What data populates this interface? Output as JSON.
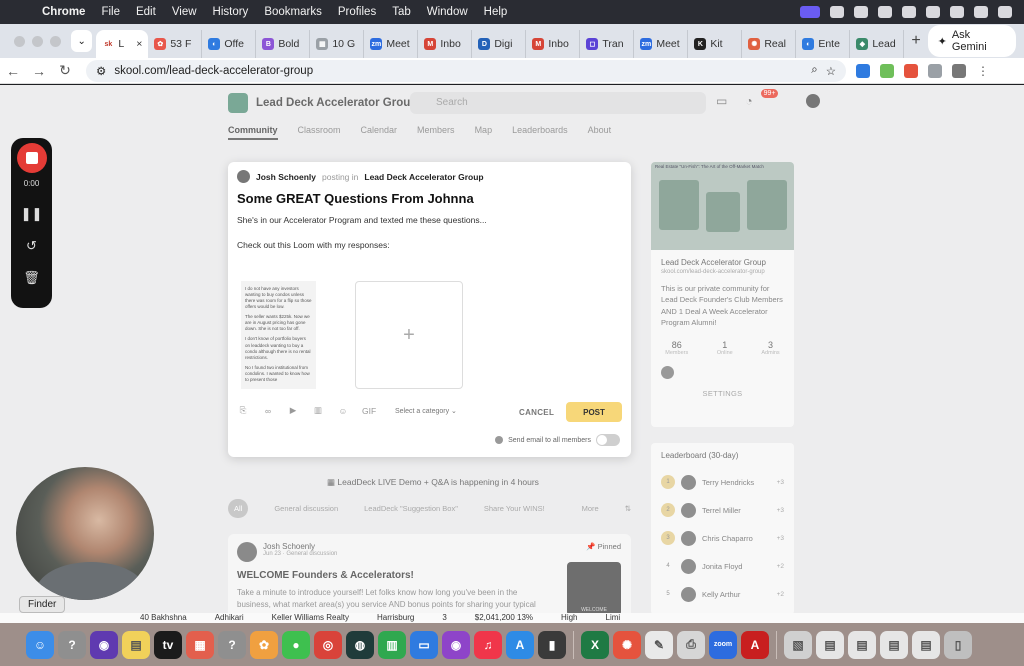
{
  "menubar": {
    "app": "Chrome",
    "items": [
      "File",
      "Edit",
      "View",
      "History",
      "Bookmarks",
      "Profiles",
      "Tab",
      "Window",
      "Help"
    ]
  },
  "tabs": [
    {
      "label": "L",
      "fav": "sk",
      "color": "#ffffff",
      "active": true
    },
    {
      "label": "53 F",
      "fav": "✿",
      "color": "#e8574b"
    },
    {
      "label": "Offe",
      "fav": "◐",
      "color": "#2f7be0"
    },
    {
      "label": "Bold",
      "fav": "B",
      "color": "#8c55d6"
    },
    {
      "label": "10 G",
      "fav": "▦",
      "color": "#9aa0a6"
    },
    {
      "label": "Meet",
      "fav": "zm",
      "color": "#2d6cdf"
    },
    {
      "label": "Inbo",
      "fav": "M",
      "color": "#d64537"
    },
    {
      "label": "Digi",
      "fav": "D",
      "color": "#2361b8"
    },
    {
      "label": "Inbo",
      "fav": "M",
      "color": "#d64537"
    },
    {
      "label": "Tran",
      "fav": "◻",
      "color": "#5b43d6"
    },
    {
      "label": "Meet",
      "fav": "zm",
      "color": "#2d6cdf"
    },
    {
      "label": "Kit",
      "fav": "K",
      "color": "#222222"
    },
    {
      "label": "Real",
      "fav": "✺",
      "color": "#e06040"
    },
    {
      "label": "Ente",
      "fav": "◐",
      "color": "#2f7be0"
    },
    {
      "label": "Lead",
      "fav": "◆",
      "color": "#3b8a6a"
    }
  ],
  "browser": {
    "new_tab": "+",
    "ask_gemini": "Ask Gemini",
    "url": "skool.com/lead-deck-accelerator-group"
  },
  "skool": {
    "group_name": "Lead Deck Accelerator Group",
    "search_placeholder": "Search",
    "notif_badge": "99+",
    "nav": [
      "Community",
      "Classroom",
      "Calendar",
      "Members",
      "Map",
      "Leaderboards",
      "About"
    ]
  },
  "composer": {
    "author": "Josh Schoenly",
    "posting_in": "posting in",
    "group": "Lead Deck Accelerator Group",
    "title": "Some GREAT Questions From Johnna",
    "body_line1": "She's in our Accelerator Program and texted me these questions...",
    "body_line2": "Check out this Loom with my responses:",
    "thumb_lines": [
      "I do not have any investors wanting to buy condos unless there was room for a flip so those offers would be low.",
      "The seller wants $225k. Now we are in August pricing has gone down. She is not too far off.",
      "I don't know of portfolio buyers on leaddeck wanting to buy a condo although there is no rental restrictions.",
      "No I found two institutional from condolins. I wanted to know how to present those"
    ],
    "add_symbol": "+",
    "gif_label": "GIF",
    "category_placeholder": "Select a category",
    "cancel_label": "CANCEL",
    "post_label": "POST",
    "email_label": "Send email to all members"
  },
  "feed": {
    "live_banner": "LeadDeck LIVE Demo + Q&A is happening in 4 hours",
    "filters": [
      "All",
      "General discussion",
      "LeadDeck \"Suggestion Box\"",
      "Share Your WINS!",
      "More"
    ],
    "pinned_post": {
      "author": "Josh Schoenly",
      "meta": "Jun 23 · General discussion",
      "pinned_label": "Pinned",
      "title": "WELCOME Founders & Accelerators!",
      "body": "Take a minute to introduce yourself! Let folks know how long you've been in the business, what market area(s) you service AND bonus points for sharing your typical",
      "image_caption": "WELCOME"
    }
  },
  "about": {
    "cover_title": "Real Estate \"Un-Fish\": The Art of the Off-Market Match",
    "name": "Lead Deck Accelerator Group",
    "url": "skool.com/lead-deck-accelerator-group",
    "description": "This is our private community for Lead Deck Founder's Club Members AND 1 Deal A Week Accelerator Program Alumni!",
    "stats": [
      {
        "value": "86",
        "label": "Members"
      },
      {
        "value": "1",
        "label": "Online"
      },
      {
        "value": "3",
        "label": "Admins"
      }
    ],
    "settings_label": "SETTINGS"
  },
  "leaderboard": {
    "title": "Leaderboard (30-day)",
    "rows": [
      {
        "rank": "1",
        "name": "Terry Hendricks",
        "points": "+3"
      },
      {
        "rank": "2",
        "name": "Terrel Miller",
        "points": "+3"
      },
      {
        "rank": "3",
        "name": "Chris Chaparro",
        "points": "+3"
      },
      {
        "rank": "4",
        "name": "Jonita Floyd",
        "points": "+2"
      },
      {
        "rank": "5",
        "name": "Kelly Arthur",
        "points": "+2"
      }
    ]
  },
  "loom": {
    "timer": "0:00"
  },
  "finder_tooltip": "Finder",
  "sheet_peek": [
    "40  Bakhshna",
    "Adhikari",
    "Keller Williams Realty",
    "Harrisburg",
    "3",
    "$2,041,200  13%",
    "High",
    "Limi"
  ],
  "dock": [
    {
      "name": "finder-icon",
      "glyph": "☺",
      "color": "#3c8de8"
    },
    {
      "name": "help-icon",
      "glyph": "?",
      "color": "#8f8f8f"
    },
    {
      "name": "siri-icon",
      "glyph": "◉",
      "color": "#5f3ab0"
    },
    {
      "name": "notes-icon",
      "glyph": "▤",
      "color": "#f1d15a"
    },
    {
      "name": "apple-tv-icon",
      "glyph": "tv",
      "color": "#1b1b1b"
    },
    {
      "name": "launchpad-icon",
      "glyph": "▦",
      "color": "#e35f4d"
    },
    {
      "name": "help-icon-2",
      "glyph": "?",
      "color": "#8f8f8f"
    },
    {
      "name": "photos-icon",
      "glyph": "✿",
      "color": "#f0a040"
    },
    {
      "name": "messages-icon",
      "glyph": "●",
      "color": "#3ec04f"
    },
    {
      "name": "chrome-icon",
      "glyph": "◎",
      "color": "#d9433a"
    },
    {
      "name": "perplexity-icon",
      "glyph": "◍",
      "color": "#1f3b3a"
    },
    {
      "name": "numbers-icon",
      "glyph": "▥",
      "color": "#2fa84f"
    },
    {
      "name": "keynote-icon",
      "glyph": "▭",
      "color": "#2f7be0"
    },
    {
      "name": "podcasts-icon",
      "glyph": "◉",
      "color": "#8e44c9"
    },
    {
      "name": "music-icon",
      "glyph": "♫",
      "color": "#f0364a"
    },
    {
      "name": "app-store-icon",
      "glyph": "A",
      "color": "#2e8be6"
    },
    {
      "name": "books-icon",
      "glyph": "▮",
      "color": "#3a3a3a"
    },
    {
      "name": "excel-icon",
      "glyph": "X",
      "color": "#1f7a44"
    },
    {
      "name": "zoom-app-icon-1",
      "glyph": "✺",
      "color": "#e5533d"
    },
    {
      "name": "pages-icon",
      "glyph": "✎",
      "color": "#e9e9e9"
    },
    {
      "name": "printer-icon",
      "glyph": "⎙",
      "color": "#d6d6d6"
    },
    {
      "name": "zoom-icon",
      "glyph": "zoom",
      "color": "#2d6cdf"
    },
    {
      "name": "acrobat-icon",
      "glyph": "A",
      "color": "#c81f1f"
    },
    {
      "name": "preview-icon",
      "glyph": "▧",
      "color": "#d0d0d0"
    },
    {
      "name": "doc-icon-1",
      "glyph": "▤",
      "color": "#e6e6e6"
    },
    {
      "name": "doc-icon-2",
      "glyph": "▤",
      "color": "#e6e6e6"
    },
    {
      "name": "doc-icon-3",
      "glyph": "▤",
      "color": "#e6e6e6"
    },
    {
      "name": "doc-icon-4",
      "glyph": "▤",
      "color": "#e6e6e6"
    },
    {
      "name": "trash-icon",
      "glyph": "▯",
      "color": "#bfbfbf"
    }
  ]
}
